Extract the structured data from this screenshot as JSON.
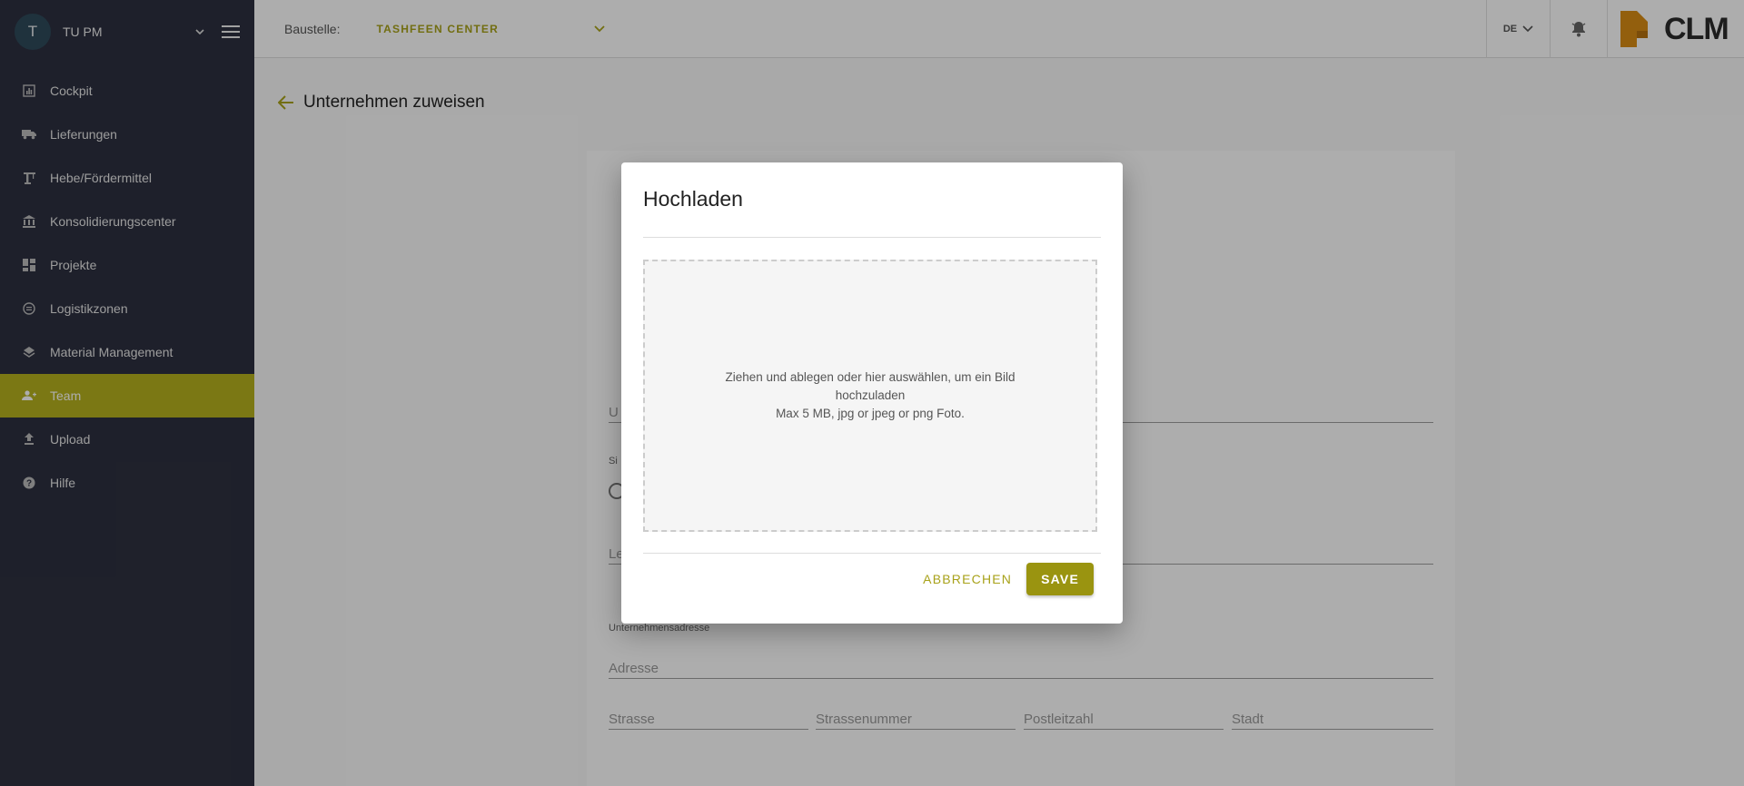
{
  "user": {
    "initial": "T",
    "name": "TU PM"
  },
  "nav": {
    "items": [
      {
        "label": "Cockpit",
        "icon": "chart-icon"
      },
      {
        "label": "Lieferungen",
        "icon": "truck-icon"
      },
      {
        "label": "Hebe/Fördermittel",
        "icon": "crane-icon"
      },
      {
        "label": "Konsolidierungscenter",
        "icon": "bank-icon"
      },
      {
        "label": "Projekte",
        "icon": "dashboard-icon"
      },
      {
        "label": "Logistikzonen",
        "icon": "zone-icon"
      },
      {
        "label": "Material Management",
        "icon": "layers-icon"
      },
      {
        "label": "Team",
        "icon": "team-icon",
        "active": true
      },
      {
        "label": "Upload",
        "icon": "upload-icon"
      },
      {
        "label": "Hilfe",
        "icon": "help-icon"
      }
    ]
  },
  "topbar": {
    "site_label": "Baustelle:",
    "site_value": "TASHFEEN CENTER",
    "language": "DE",
    "logo_text": "CLM"
  },
  "page": {
    "title": "Unternehmen zuweisen",
    "fields": {
      "company_partial": "U",
      "section_partial": "Si",
      "leader_partial": "Le",
      "address_section": "Unternehmensadresse",
      "address": "Adresse",
      "street": "Strasse",
      "street_number": "Strassenummer",
      "postal_code": "Postleitzahl",
      "city": "Stadt"
    }
  },
  "modal": {
    "title": "Hochladen",
    "dropzone_line1": "Ziehen und ablegen oder hier auswählen, um ein Bild hochzuladen",
    "dropzone_line2": "Max 5 MB, jpg or jpeg or png Foto.",
    "cancel_label": "ABBRECHEN",
    "save_label": "SAVE"
  },
  "colors": {
    "accent": "#a8a21a",
    "sidebar_bg": "#2d3040",
    "active_nav": "#b5b21e",
    "logo_orange": "#d98c14"
  }
}
